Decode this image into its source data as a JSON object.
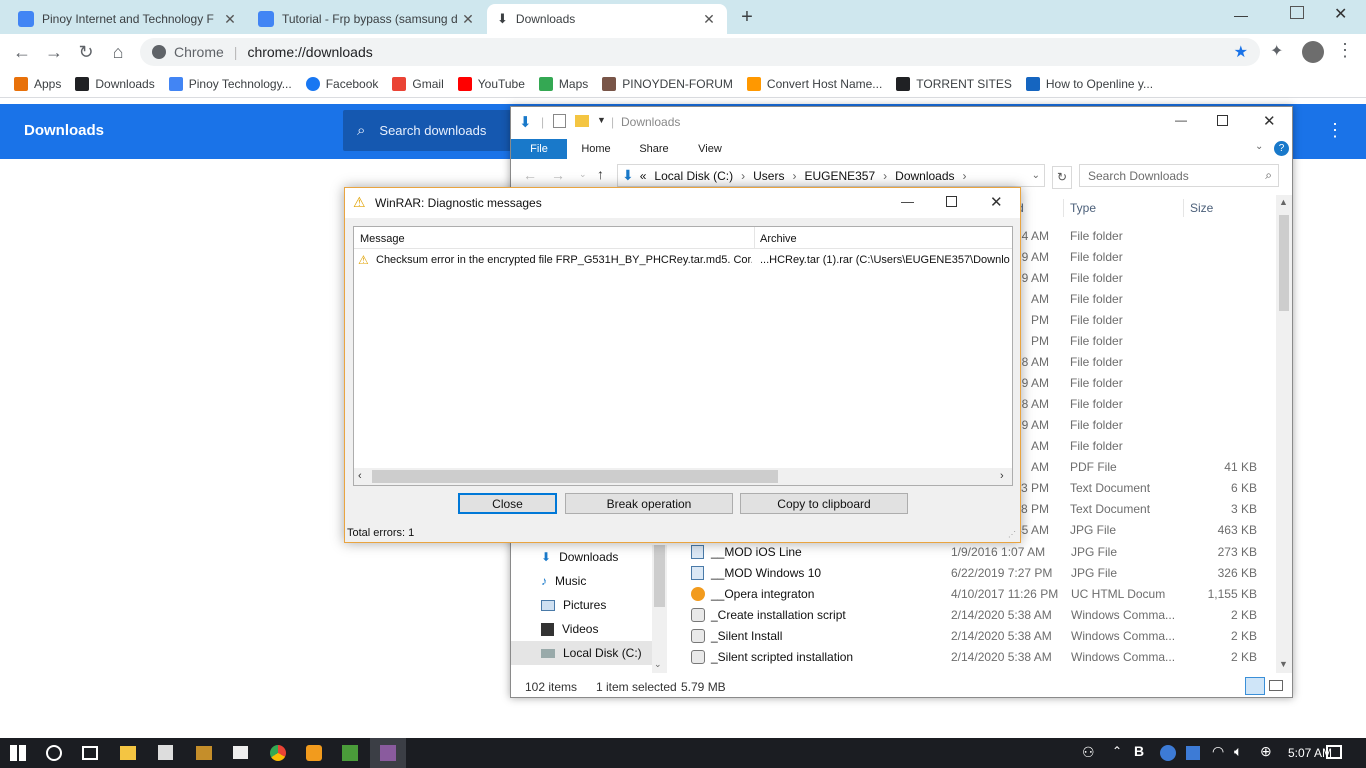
{
  "chrome": {
    "tabs": [
      {
        "title": "Pinoy Internet and Technology F",
        "color": "#4285f4"
      },
      {
        "title": "Tutorial - Frp bypass (samsung d",
        "color": "#4285f4"
      },
      {
        "title": "Downloads",
        "color": "#202124"
      }
    ],
    "omnibox": {
      "site": "Chrome",
      "url": "chrome://downloads"
    },
    "bookmarks": [
      {
        "label": "Apps",
        "color": "#e8710a"
      },
      {
        "label": "Downloads",
        "color": "#202124"
      },
      {
        "label": "Pinoy Technology...",
        "color": "#4285f4"
      },
      {
        "label": "Facebook",
        "color": "#1877f2"
      },
      {
        "label": "Gmail",
        "color": "#ea4335"
      },
      {
        "label": "YouTube",
        "color": "#ff0000"
      },
      {
        "label": "Maps",
        "color": "#34a853"
      },
      {
        "label": "PINOYDEN-FORUM",
        "color": "#795548"
      },
      {
        "label": "Convert Host Name...",
        "color": "#ff9800"
      },
      {
        "label": "TORRENT SITES",
        "color": "#202124"
      },
      {
        "label": "How to Openline y...",
        "color": "#1565c0"
      }
    ],
    "downloads_page": {
      "title": "Downloads",
      "search_placeholder": "Search downloads"
    }
  },
  "explorer": {
    "title": "Downloads",
    "ribbon_tabs": [
      "File",
      "Home",
      "Share",
      "View"
    ],
    "breadcrumb": [
      "Local Disk (C:)",
      "Users",
      "EUGENE357",
      "Downloads"
    ],
    "breadcrumb_prefix": "«",
    "search_placeholder": "Search Downloads",
    "columns": {
      "date_partial": "d",
      "type": "Type",
      "size": "Size"
    },
    "partial_rows": [
      {
        "date": "4 AM",
        "type": "File folder",
        "size": ""
      },
      {
        "date": "9 AM",
        "type": "File folder",
        "size": ""
      },
      {
        "date": "9 AM",
        "type": "File folder",
        "size": ""
      },
      {
        "date": "AM",
        "type": "File folder",
        "size": ""
      },
      {
        "date": "PM",
        "type": "File folder",
        "size": ""
      },
      {
        "date": "PM",
        "type": "File folder",
        "size": ""
      },
      {
        "date": "8 AM",
        "type": "File folder",
        "size": ""
      },
      {
        "date": "9 AM",
        "type": "File folder",
        "size": ""
      },
      {
        "date": "8 AM",
        "type": "File folder",
        "size": ""
      },
      {
        "date": "9 AM",
        "type": "File folder",
        "size": ""
      },
      {
        "date": "AM",
        "type": "File folder",
        "size": ""
      },
      {
        "date": "AM",
        "type": "PDF File",
        "size": "41 KB"
      },
      {
        "date": "43 PM",
        "type": "Text Document",
        "size": "6 KB"
      },
      {
        "date": "8 PM",
        "type": "Text Document",
        "size": "3 KB"
      },
      {
        "date": "45 AM",
        "type": "JPG File",
        "size": "463 KB"
      }
    ],
    "rows": [
      {
        "name": "__MOD iOS Line",
        "date": "1/9/2016 1:07 AM",
        "type": "JPG File",
        "size": "273 KB",
        "icon": "jpg"
      },
      {
        "name": "__MOD Windows 10",
        "date": "6/22/2019 7:27 PM",
        "type": "JPG File",
        "size": "326 KB",
        "icon": "jpg"
      },
      {
        "name": "__Opera integraton",
        "date": "4/10/2017 11:26 PM",
        "type": "UC HTML Docum",
        "size": "1,155 KB",
        "icon": "uc"
      },
      {
        "name": "_Create installation script",
        "date": "2/14/2020 5:38 AM",
        "type": "Windows Comma...",
        "size": "2 KB",
        "icon": "cmd"
      },
      {
        "name": "_Silent Install",
        "date": "2/14/2020 5:38 AM",
        "type": "Windows Comma...",
        "size": "2 KB",
        "icon": "cmd"
      },
      {
        "name": "_Silent scripted installation",
        "date": "2/14/2020 5:38 AM",
        "type": "Windows Comma...",
        "size": "2 KB",
        "icon": "cmd"
      }
    ],
    "nav_items": [
      "Downloads",
      "Music",
      "Pictures",
      "Videos",
      "Local Disk (C:)"
    ],
    "status": {
      "items": "102 items",
      "selected": "1 item selected",
      "size": "5.79 MB"
    }
  },
  "winrar": {
    "title": "WinRAR: Diagnostic messages",
    "columns": {
      "message": "Message",
      "archive": "Archive"
    },
    "message": "Checksum error in the encrypted file FRP_G531H_BY_PHCRey.tar.md5. Cor...",
    "archive": "...HCRey.tar (1).rar (C:\\Users\\EUGENE357\\Downloa",
    "buttons": {
      "close": "Close",
      "break": "Break operation",
      "copy": "Copy to clipboard"
    },
    "total_errors": "Total errors: 1"
  },
  "taskbar": {
    "time": "5:07 AM"
  },
  "colors": {
    "chrome_blue": "#1a73e8",
    "explorer_accent": "#1979ca",
    "winrar_border": "#e9a440"
  }
}
